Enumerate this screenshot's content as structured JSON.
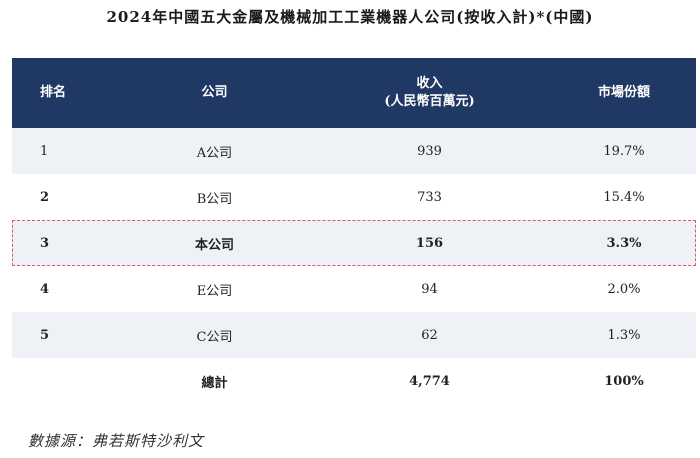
{
  "title": "2024年中國五大金屬及機械加工工業機器人公司(按收入計)*(中國)",
  "table": {
    "headers": {
      "rank": "排名",
      "company": "公司",
      "revenue_line1": "收入",
      "revenue_line2": "(人民幣百萬元)",
      "share": "市場份額"
    },
    "rows": [
      {
        "rank": "1",
        "company": "A公司",
        "revenue": "939",
        "share": "19.7%"
      },
      {
        "rank": "2",
        "company": "B公司",
        "revenue": "733",
        "share": "15.4%"
      },
      {
        "rank": "3",
        "company": "本公司",
        "revenue": "156",
        "share": "3.3%"
      },
      {
        "rank": "4",
        "company": "E公司",
        "revenue": "94",
        "share": "2.0%"
      },
      {
        "rank": "5",
        "company": "C公司",
        "revenue": "62",
        "share": "1.3%"
      }
    ],
    "total": {
      "label": "總計",
      "revenue": "4,774",
      "share": "100%"
    }
  },
  "source": "數據源：弗若斯特沙利文",
  "colors": {
    "header_bg": "#1f3864",
    "highlight_border": "#e0556b",
    "row_shade": "#eef1f6"
  }
}
